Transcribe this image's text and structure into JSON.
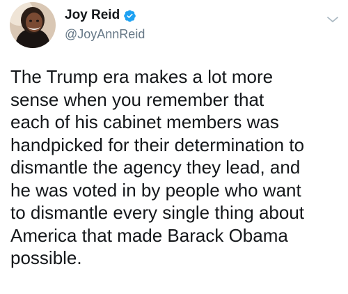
{
  "tweet": {
    "author": {
      "display_name": "Joy Reid",
      "handle": "@JoyAnnReid",
      "verified": true,
      "avatar_icon": "profile-photo"
    },
    "menu_icon": "chevron-down-icon",
    "text_lines": [
      "The Trump era makes a lot more",
      "sense when you remember that",
      "each of his cabinet members was",
      "handpicked for their determination to",
      "dismantle the agency they lead, and",
      "he was voted in by people who want",
      "to dismantle every single thing about",
      "America that made Barack Obama",
      "possible."
    ]
  },
  "colors": {
    "text": "#14171a",
    "secondary_text": "#657786",
    "verified_badge": "#1da1f2",
    "caret": "#aab8c2"
  }
}
